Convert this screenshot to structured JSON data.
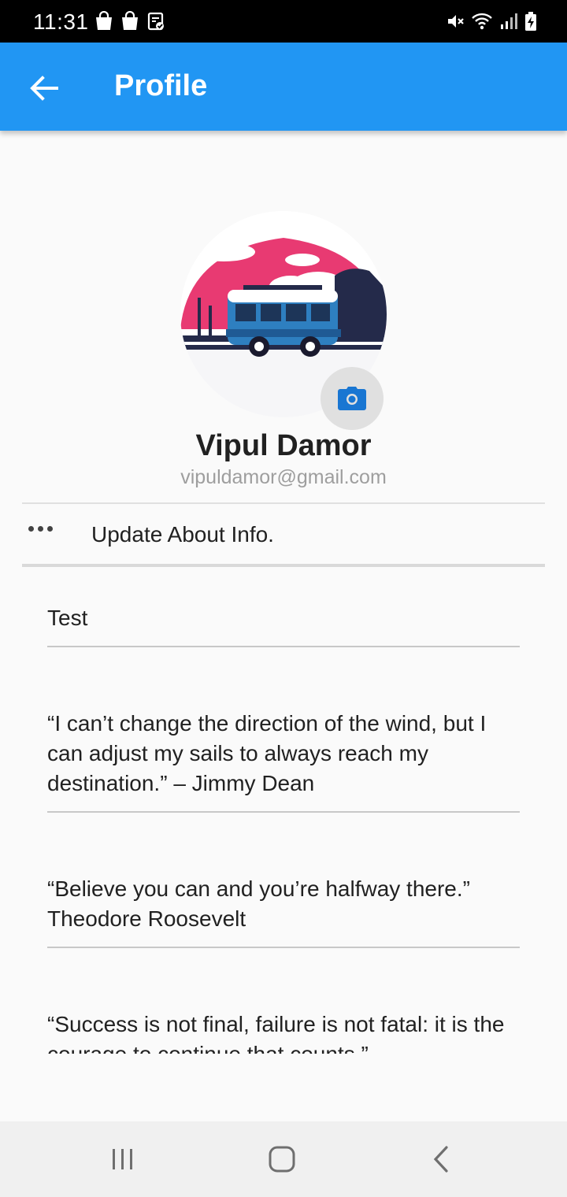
{
  "status_bar": {
    "time": "11:31",
    "left_icons": [
      "shopping-bag-icon",
      "shopping-bag-icon",
      "clipboard-check-icon"
    ],
    "right_icons": [
      "mute-icon",
      "wifi-icon",
      "signal-icon",
      "battery-charging-icon"
    ]
  },
  "app_bar": {
    "title": "Profile",
    "back_icon": "arrow-left-icon",
    "background": "#2196f3"
  },
  "profile": {
    "name": "Vipul Damor",
    "email": "vipuldamor@gmail.com",
    "camera_icon": "camera-icon"
  },
  "about": {
    "label": "Update About Info.",
    "icon": "more-horizontal-icon"
  },
  "quotes": [
    "Test",
    "“I can’t change the direction of the wind, but I can adjust my sails to always reach my destination.” – Jimmy Dean",
    " “Believe you can and you’re halfway there.” Theodore Roosevelt",
    "“Success is not final, failure is not fatal: it is the courage to continue that counts.”"
  ],
  "nav_bar": {
    "items": [
      "recent-apps-icon",
      "home-icon",
      "back-icon"
    ]
  }
}
